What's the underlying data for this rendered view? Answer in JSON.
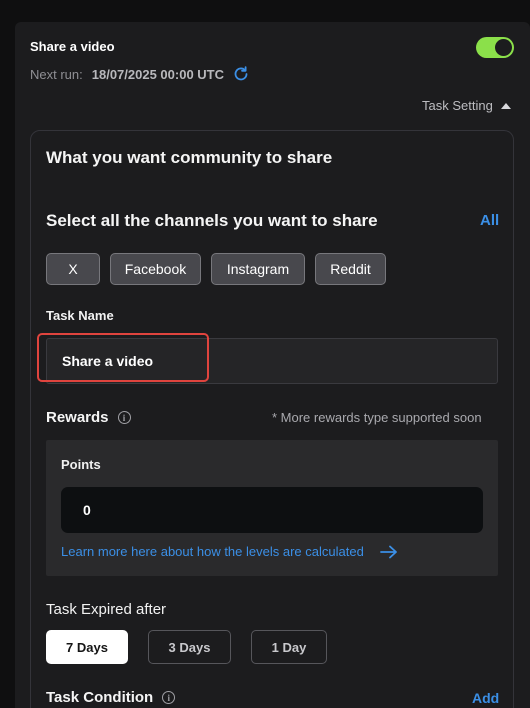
{
  "task": {
    "title": "Share a video",
    "toggle_on": true,
    "next_run_label": "Next run:",
    "next_run_value": "18/07/2025 00:00 UTC",
    "task_setting_label": "Task Setting"
  },
  "share": {
    "heading": "What you want community to share",
    "channels_heading": "Select all the channels you want to share",
    "all_label": "All",
    "channels": [
      "X",
      "Facebook",
      "Instagram",
      "Reddit"
    ]
  },
  "task_name": {
    "label": "Task Name",
    "value": "Share a video"
  },
  "rewards": {
    "label": "Rewards",
    "note": "* More rewards type supported soon",
    "points_label": "Points",
    "points_value": "0",
    "learn_more": "Learn more here about how the levels are calculated"
  },
  "expiry": {
    "label": "Task Expired after",
    "options": [
      "7 Days",
      "3 Days",
      "1 Day"
    ],
    "selected": "7 Days"
  },
  "condition": {
    "label": "Task Condition",
    "add_label": "Add"
  },
  "colors": {
    "accent_blue": "#3b8fe6",
    "toggle_green": "#8be04a",
    "highlight_red": "#e0443e"
  }
}
